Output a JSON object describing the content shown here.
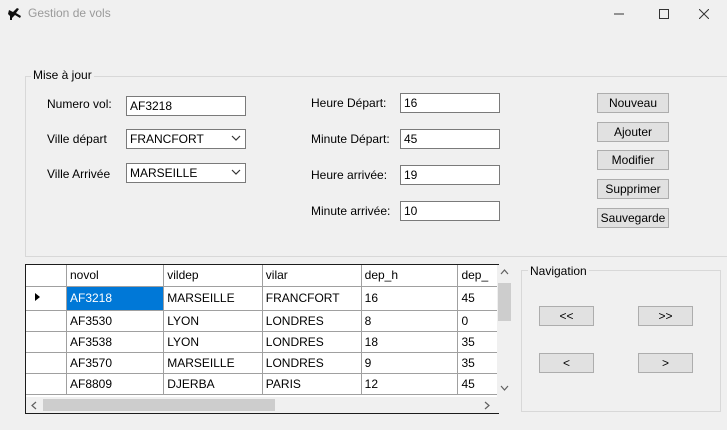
{
  "window": {
    "title": "Gestion de vols",
    "minimize_icon": "minimize-icon",
    "maximize_icon": "maximize-icon",
    "close_icon": "close-icon"
  },
  "update_group": {
    "title": "Mise à jour",
    "numero_vol_label": "Numero vol:",
    "numero_vol_value": "AF3218",
    "ville_depart_label": "Ville départ",
    "ville_depart_value": "FRANCFORT",
    "ville_arrivee_label": "Ville Arrivée",
    "ville_arrivee_value": "MARSEILLE",
    "heure_depart_label": "Heure Départ:",
    "heure_depart_value": "16",
    "minute_depart_label": "Minute Départ:",
    "minute_depart_value": "45",
    "heure_arrivee_label": "Heure arrivée:",
    "heure_arrivee_value": "19",
    "minute_arrivee_label": "Minute arrivée:",
    "minute_arrivee_value": "10"
  },
  "actions": {
    "nouveau": "Nouveau",
    "ajouter": "Ajouter",
    "modifier": "Modifier",
    "supprimer": "Supprimer",
    "sauvegarde": "Sauvegarde"
  },
  "grid": {
    "columns": [
      "novol",
      "vildep",
      "vilar",
      "dep_h",
      "dep_"
    ],
    "rows": [
      [
        "AF3218",
        "MARSEILLE",
        "FRANCFORT",
        "16",
        "45"
      ],
      [
        "AF3530",
        "LYON",
        "LONDRES",
        "8",
        "0"
      ],
      [
        "AF3538",
        "LYON",
        "LONDRES",
        "18",
        "35"
      ],
      [
        "AF3570",
        "MARSEILLE",
        "LONDRES",
        "9",
        "35"
      ],
      [
        "AF8809",
        "DJERBA",
        "PARIS",
        "12",
        "45"
      ]
    ],
    "selected_row": 0
  },
  "navigation": {
    "title": "Navigation",
    "first": "<<",
    "last": ">>",
    "prev": "<",
    "next": ">"
  },
  "colors": {
    "selection": "#0078d7",
    "window_bg": "#f0f0f0"
  }
}
